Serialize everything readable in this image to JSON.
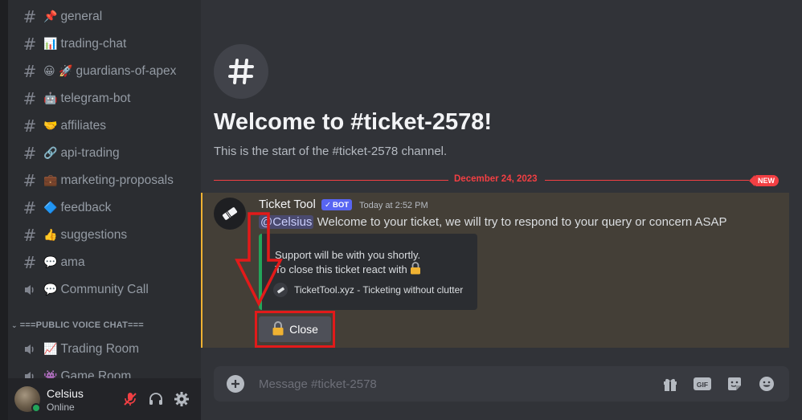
{
  "sidebar": {
    "channels": [
      {
        "emoji": "📌",
        "label": "general",
        "type": "text"
      },
      {
        "emoji": "📊",
        "label": "trading-chat",
        "type": "text"
      },
      {
        "emoji": "😀 🚀",
        "label": "guardians-of-apex",
        "type": "text"
      },
      {
        "emoji": "🤖",
        "label": "telegram-bot",
        "type": "text"
      },
      {
        "emoji": "🤝",
        "label": "affiliates",
        "type": "text"
      },
      {
        "emoji": "🔗",
        "label": "api-trading",
        "type": "text"
      },
      {
        "emoji": "💼",
        "label": "marketing-proposals",
        "type": "text"
      },
      {
        "emoji": "🔷",
        "label": "feedback",
        "type": "text"
      },
      {
        "emoji": "👍",
        "label": "suggestions",
        "type": "text"
      },
      {
        "emoji": "💬",
        "label": "ama",
        "type": "text"
      },
      {
        "emoji": "💬",
        "label": "Community Call",
        "type": "voice"
      }
    ],
    "category": "===PUBLIC VOICE CHAT===",
    "voice_channels": [
      {
        "emoji": "📈",
        "label": "Trading Room"
      },
      {
        "emoji": "👾",
        "label": "Game Room"
      }
    ]
  },
  "user": {
    "name": "Celsius",
    "status": "Online"
  },
  "channel": {
    "welcome_title": "Welcome to #ticket-2578!",
    "welcome_subtitle": "This is the start of the #ticket-2578 channel.",
    "date_divider": "December 24, 2023",
    "new_badge": "NEW"
  },
  "message": {
    "author": "Ticket Tool",
    "bot_tag": "BOT",
    "timestamp": "Today at 2:52 PM",
    "mention": "@Celsius",
    "text": " Welcome to your ticket, we will try to respond to your query or concern ASAP",
    "embed": {
      "line1": "Support will be with you shortly.",
      "line2": "To close this ticket react with",
      "footer": "TicketTool.xyz - Ticketing without clutter"
    },
    "button_label": "Close"
  },
  "composer": {
    "placeholder": "Message #ticket-2578"
  },
  "colors": {
    "accent_red": "#f23f43",
    "embed_green": "#23a55a",
    "bot_blurple": "#5865f2",
    "highlight": "#e21a1a"
  }
}
